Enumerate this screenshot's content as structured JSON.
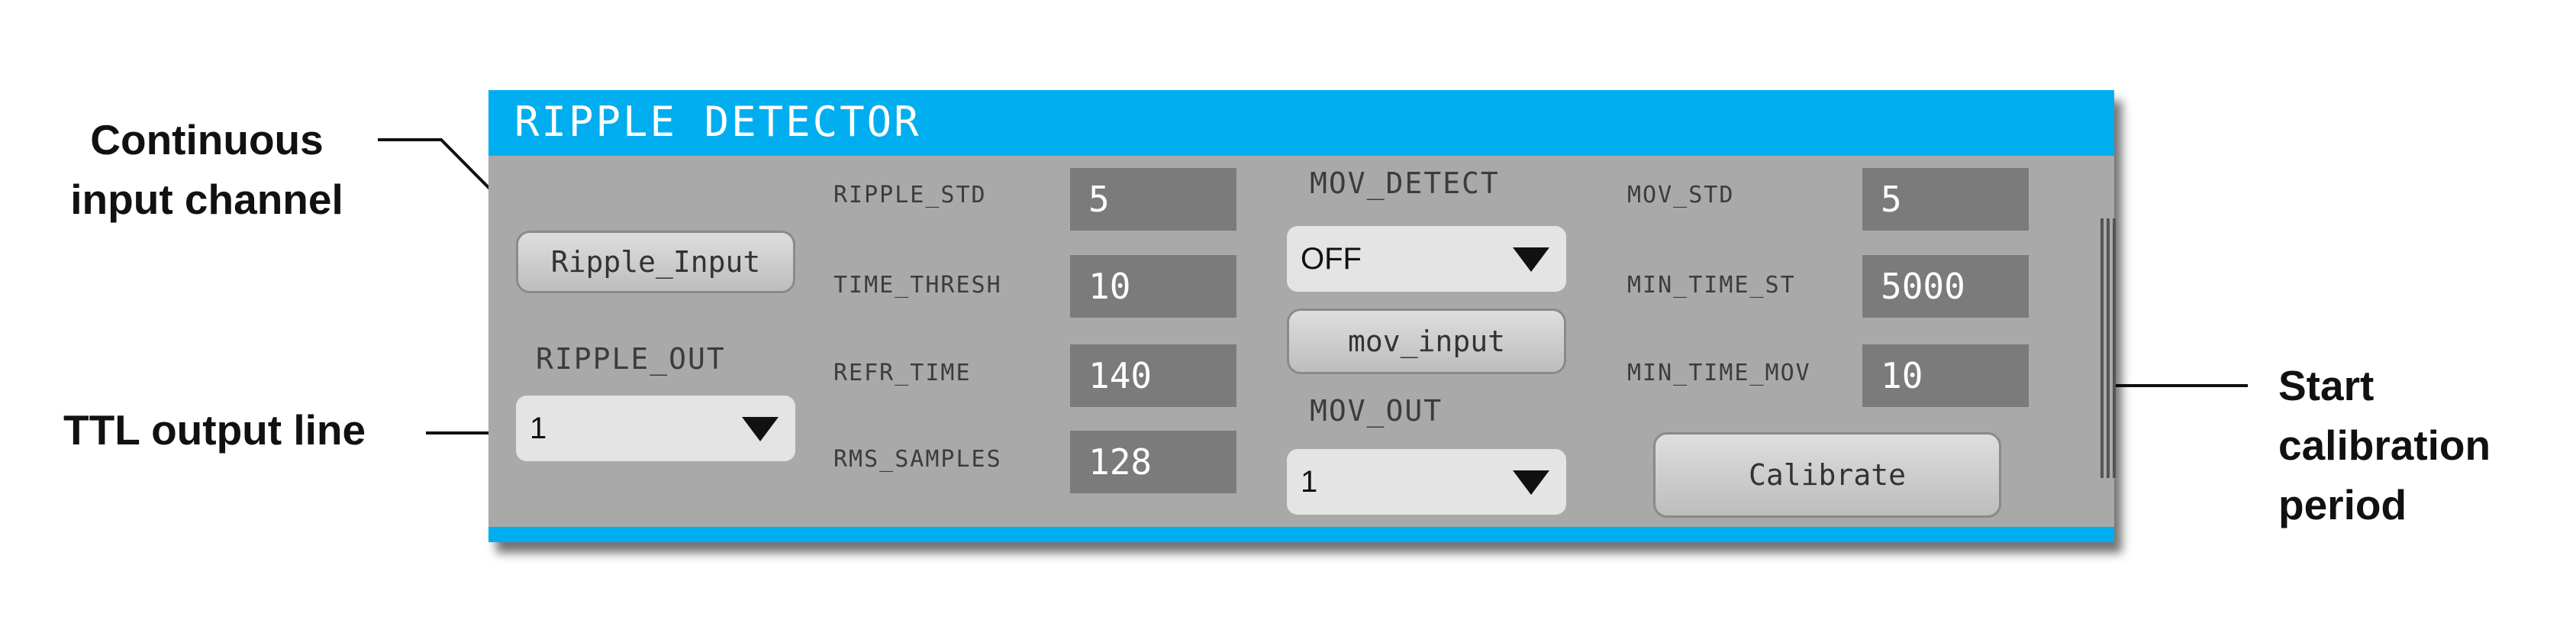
{
  "panel": {
    "title": "RIPPLE DETECTOR",
    "ripple_input_button": "Ripple_Input",
    "ripple_out_label": "RIPPLE_OUT",
    "ripple_out_value": "1",
    "params_left": [
      {
        "label": "RIPPLE_STD",
        "value": "5"
      },
      {
        "label": "TIME_THRESH",
        "value": "10"
      },
      {
        "label": "REFR_TIME",
        "value": "140"
      },
      {
        "label": "RMS_SAMPLES",
        "value": "128"
      }
    ],
    "mov_detect_label": "MOV_DETECT",
    "mov_detect_value": "OFF",
    "mov_input_button": "mov_input",
    "mov_out_label": "MOV_OUT",
    "mov_out_value": "1",
    "params_right": [
      {
        "label": "MOV_STD",
        "value": "5"
      },
      {
        "label": "MIN_TIME_ST",
        "value": "5000"
      },
      {
        "label": "MIN_TIME_MOV",
        "value": "10"
      }
    ],
    "calibrate_button": "Calibrate"
  },
  "callouts": {
    "continuous_line1": "Continuous",
    "continuous_line2": "input channel",
    "ttl": "TTL output line",
    "start_line1": "Start",
    "start_line2": "calibration",
    "start_line3": "period"
  }
}
